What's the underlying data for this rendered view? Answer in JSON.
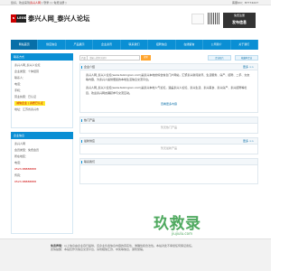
{
  "topbar": {
    "left_prefix": "您好，欢迎来到",
    "left_site": "泰兴人网",
    "left_links": "[ 登录 ] [ 免费注册 ]",
    "right": "客服QQ：87774227"
  },
  "header": {
    "logo_mini": "N",
    "logo_main": "LEOD",
    "title": "泰兴人网_泰兴人论坛",
    "url": "www.taixingren.com",
    "box_line1": "免费注册",
    "box_line2": "发布信息"
  },
  "nav": [
    "网站首页",
    "供应信息",
    "产品展示",
    "企业资讯",
    "联系我们",
    "招聘信息",
    "在线留言",
    "公司简介",
    "关于我们"
  ],
  "sidebar": {
    "contact_title": "联系方式",
    "contact_lines": [
      "泰兴人网_泰兴人论坛",
      "企业类型：个体经营",
      "联系人：",
      "电话：",
      "手机：",
      "营业执照：已认证"
    ],
    "highlight": "诚信企业 | 资质已认证",
    "address_label": "地址：",
    "address": "江苏省泰兴市",
    "info_title": "企业信息",
    "info_lines": [
      "泰兴人网",
      "会员类型：免费会员",
      "所在地区：",
      "电话：",
      "传真："
    ],
    "phones": [
      "0523-88888888",
      "0523-88888888"
    ]
  },
  "search": {
    "select": "产品",
    "placeholder": "请输入搜索关键字",
    "button": "搜索",
    "action1": "企业名片",
    "action2": "收藏本企业"
  },
  "about": {
    "title": "企业介绍",
    "more": "更多 >>",
    "p1": "泰兴人网_泰兴人论坛(www.taixingren.com)是泰兴本地的综合信息门户网站，汇聚泰兴新闻资讯、生活服务、房产、招聘、二手、交友等内容，为泰兴人提供便捷的本地生活信息交流平台。",
    "p2": "泰兴人网_泰兴人论坛(www.taixingren.com)是泰兴本地人气论坛，涵盖泰兴人论坛、泰兴生活、泰兴美食、泰兴房产、泰兴招聘等栏目，欢迎泰兴网友踊跃参与交流互动。",
    "link": "查看更多内容"
  },
  "hot": {
    "title": "热门产品",
    "empty": "暂无热门产品"
  },
  "latest": {
    "title": "最新供应",
    "more": "更多 >>",
    "empty": "暂无最新产品"
  },
  "contact2": {
    "title": "联系我们"
  },
  "footer": {
    "line1_label": "免责声明：",
    "line1": "以上信息由企业自行提供，该企业负责信息内容的真实性、准确性和合法性。本站对此不承担任何保证责任。",
    "line2": "友情提醒：本站仅作为信息交流平台，请勿相信汇款、中奖等信息，谨防受骗。"
  },
  "watermark": {
    "text": "玖救录",
    "url": "jiujiulu.com"
  },
  "colors": {
    "accent": "#0a8fd4",
    "highlight": "#ffea2a",
    "search_button": "#ffa42c"
  }
}
